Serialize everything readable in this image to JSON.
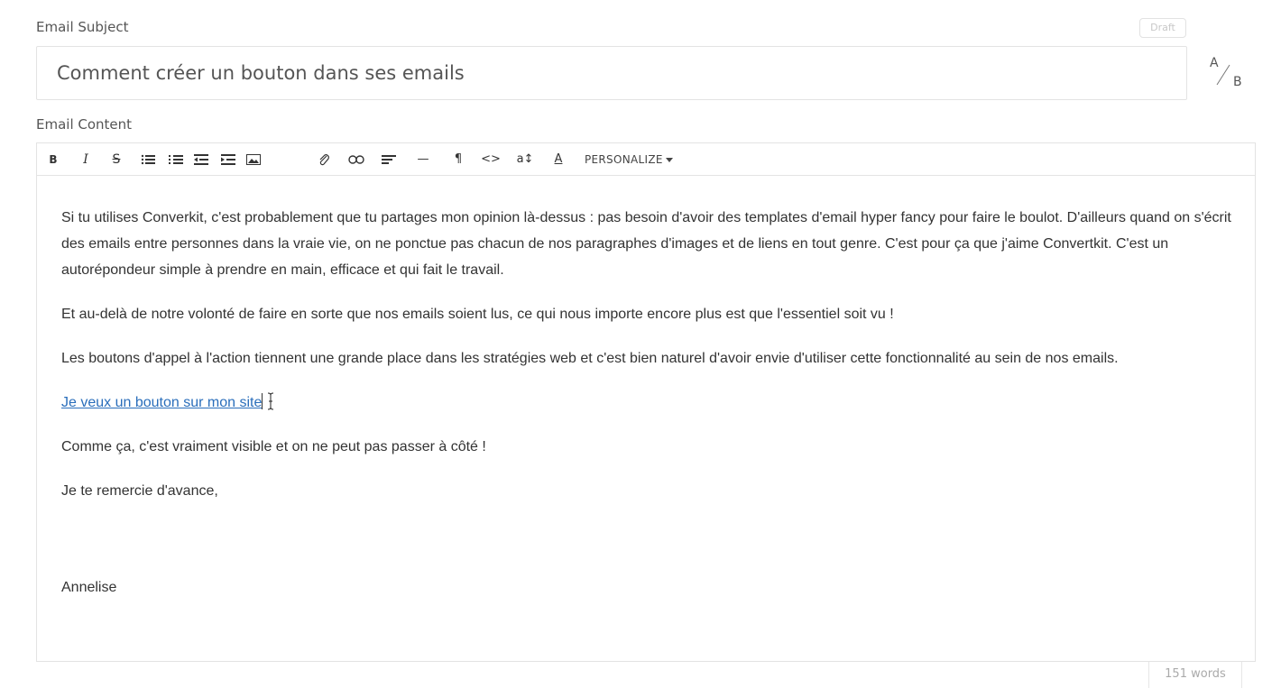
{
  "subject": {
    "label": "Email Subject",
    "status_badge": "Draft",
    "value": "Comment créer un bouton dans ses emails",
    "ab_toggle": {
      "a": "A",
      "b": "B",
      "icon": "ab-test-icon"
    }
  },
  "content": {
    "label": "Email Content",
    "toolbar": {
      "bold": "B",
      "italic": "I",
      "strikethrough": "S",
      "bulleted_list": "bulleted-list-icon",
      "numbered_list": "numbered-list-icon",
      "outdent": "outdent-icon",
      "indent": "indent-icon",
      "image": "image-icon",
      "attachment": "paperclip-icon",
      "link": "link-icon",
      "align": "align-left-icon",
      "horizontal_rule": "—",
      "pilcrow": "¶",
      "code": "<>",
      "font_size": "a↕",
      "font_color": "A",
      "personalize": "PERSONALIZE"
    },
    "body": {
      "p1": "Si tu utilises Converkit, c'est probablement que tu partages mon opinion là-dessus : pas besoin d'avoir des templates d'email hyper fancy pour faire le boulot. D'ailleurs quand on s'écrit des emails entre personnes dans la vraie vie, on ne ponctue pas chacun de nos paragraphes d'images et de liens en tout genre. C'est pour ça que j'aime Convertkit. C'est un autorépondeur simple à prendre en main, efficace et qui fait le travail.",
      "p2": "Et au-delà de notre volonté de faire en sorte que nos emails soient lus, ce qui nous importe encore plus est que l'essentiel soit vu !",
      "p3": "Les boutons d'appel à l'action tiennent une grande place dans les stratégies web et c'est bien naturel d'avoir envie d'utiliser cette fonctionnalité au sein de nos emails.",
      "link": "Je veux un bouton sur mon site",
      "p4": "Comme ça, c'est vraiment visible et on ne peut pas passer à côté !",
      "p5": "Je te remercie d'avance,",
      "signature": "Annelise"
    },
    "word_count": "151 words"
  },
  "colors": {
    "border": "#e3e3e3",
    "link": "#2a6ebb",
    "text": "#333333",
    "muted": "#aaaaaa"
  }
}
